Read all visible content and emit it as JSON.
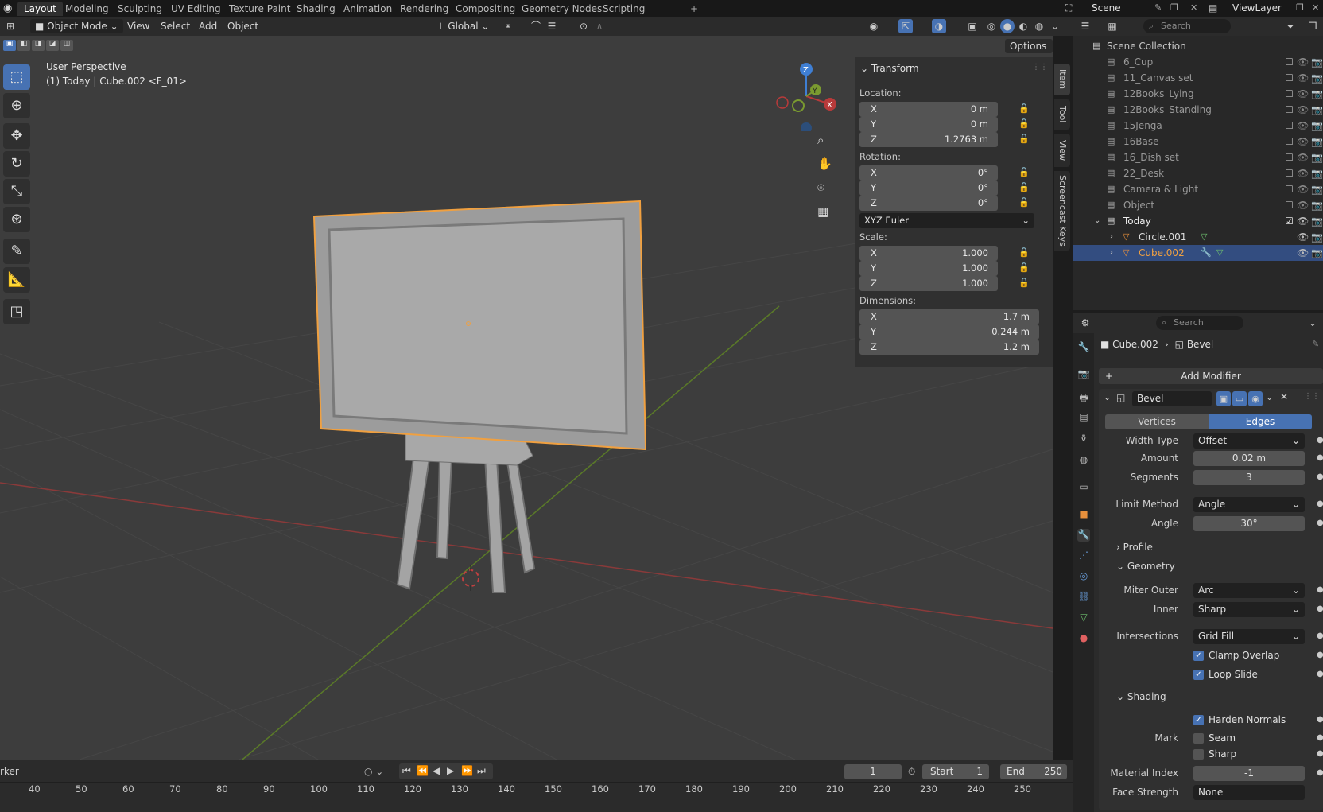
{
  "workspace_tabs": [
    "Layout",
    "Modeling",
    "Sculpting",
    "UV Editing",
    "Texture Paint",
    "Shading",
    "Animation",
    "Rendering",
    "Compositing",
    "Geometry Nodes",
    "Scripting"
  ],
  "active_workspace": "Layout",
  "scene": {
    "scene_name": "Scene",
    "view_layer": "ViewLayer"
  },
  "viewport_header": {
    "mode": "Object Mode",
    "menus": [
      "View",
      "Select",
      "Add",
      "Object"
    ],
    "orientation": "Global",
    "options_label": "Options"
  },
  "viewport": {
    "view_name": "User Perspective",
    "context": "(1) Today | Cube.002 <F_01>"
  },
  "gizmo_axes": {
    "z": "Z",
    "y": "Y",
    "x": "X"
  },
  "n_tabs": [
    "Item",
    "Tool",
    "View",
    "Screencast Keys"
  ],
  "transform": {
    "header": "Transform",
    "location_label": "Location:",
    "location": [
      {
        "axis": "X",
        "value": "0 m"
      },
      {
        "axis": "Y",
        "value": "0 m"
      },
      {
        "axis": "Z",
        "value": "1.2763 m"
      }
    ],
    "rotation_label": "Rotation:",
    "rotation": [
      {
        "axis": "X",
        "value": "0°"
      },
      {
        "axis": "Y",
        "value": "0°"
      },
      {
        "axis": "Z",
        "value": "0°"
      }
    ],
    "rotation_mode": "XYZ Euler",
    "scale_label": "Scale:",
    "scale": [
      {
        "axis": "X",
        "value": "1.000"
      },
      {
        "axis": "Y",
        "value": "1.000"
      },
      {
        "axis": "Z",
        "value": "1.000"
      }
    ],
    "dimensions_label": "Dimensions:",
    "dimensions": [
      {
        "axis": "X",
        "value": "1.7 m"
      },
      {
        "axis": "Y",
        "value": "0.244 m"
      },
      {
        "axis": "Z",
        "value": "1.2 m"
      }
    ]
  },
  "outliner": {
    "search_placeholder": "Search",
    "root": "Scene Collection",
    "collections": [
      "6_Cup",
      "11_Canvas set",
      "12Books_Lying",
      "12Books_Standing",
      "15Jenga",
      "16Base",
      "16_Dish set",
      "22_Desk",
      "Camera & Light",
      "Object"
    ],
    "active_collection": "Today",
    "objects": [
      {
        "name": "Circle.001"
      },
      {
        "name": "Cube.002"
      }
    ]
  },
  "properties": {
    "search_placeholder": "Search",
    "breadcrumb_object": "Cube.002",
    "breadcrumb_modifier": "Bevel",
    "add_modifier": "Add Modifier",
    "modifier_name": "Bevel",
    "affect_tabs": [
      "Vertices",
      "Edges"
    ],
    "active_affect": "Edges",
    "width_type_label": "Width Type",
    "width_type": "Offset",
    "amount_label": "Amount",
    "amount": "0.02 m",
    "segments_label": "Segments",
    "segments": "3",
    "limit_method_label": "Limit Method",
    "limit_method": "Angle",
    "angle_label": "Angle",
    "angle": "30°",
    "profile_section": "Profile",
    "geometry_section": "Geometry",
    "miter_outer_label": "Miter Outer",
    "miter_outer": "Arc",
    "inner_label": "Inner",
    "inner": "Sharp",
    "intersections_label": "Intersections",
    "intersections": "Grid Fill",
    "clamp_overlap": "Clamp Overlap",
    "loop_slide": "Loop Slide",
    "shading_section": "Shading",
    "harden_normals": "Harden Normals",
    "mark_label": "Mark",
    "mark_seam": "Seam",
    "mark_sharp": "Sharp",
    "material_index_label": "Material Index",
    "material_index": "-1",
    "face_strength_label": "Face Strength",
    "face_strength": "None"
  },
  "timeline": {
    "left_label": "rker",
    "current_frame": "1",
    "start_label": "Start",
    "start": "1",
    "end_label": "End",
    "end": "250",
    "ticks": [
      "40",
      "50",
      "60",
      "70",
      "80",
      "90",
      "100",
      "110",
      "120",
      "130",
      "140",
      "150",
      "160",
      "170",
      "180",
      "190",
      "200",
      "210",
      "220",
      "230",
      "240",
      "250"
    ]
  },
  "colors": {
    "accent": "#4772b3",
    "selection_outline": "#f0a040",
    "x_axis": "#b83a3a",
    "y_axis": "#7a9a30",
    "z_axis": "#3f7fd4"
  }
}
